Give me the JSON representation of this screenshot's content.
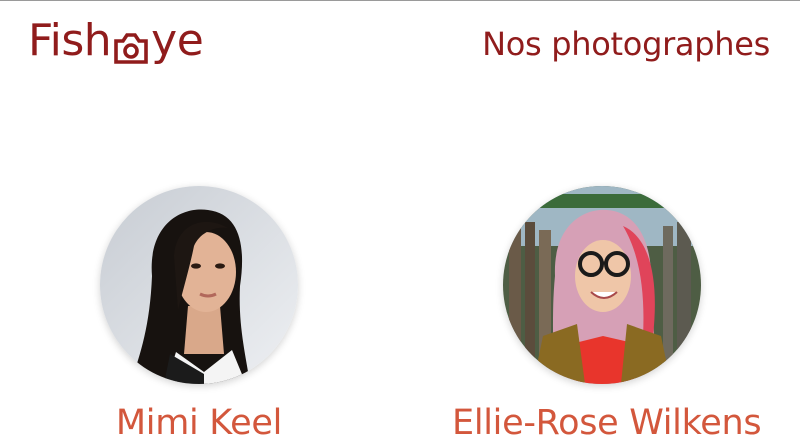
{
  "header": {
    "logo_text_before": "Fish",
    "logo_text_after": "ye",
    "logo_icon": "camera-icon",
    "title": "Nos photographes"
  },
  "photographers": [
    {
      "name": "Mimi Keel",
      "portrait_icon": "portrait-photo"
    },
    {
      "name": "Ellie-Rose Wilkens",
      "portrait_icon": "portrait-photo"
    }
  ],
  "colors": {
    "brand": "#901c1c",
    "name_accent": "#d3573c"
  }
}
